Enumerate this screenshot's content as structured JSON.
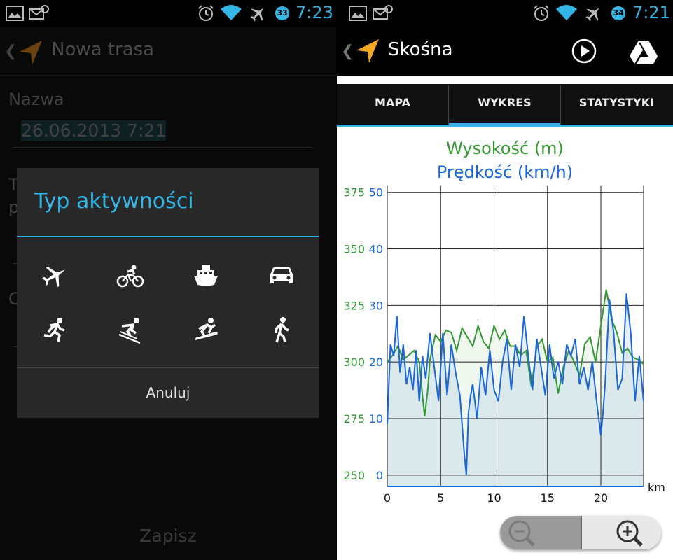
{
  "left": {
    "status": {
      "battery": "33",
      "time": "7:23"
    },
    "title": "Nowa trasa",
    "name_label": "Nazwa",
    "name_value": "26.06.2013 7:21",
    "hidden_label_fragment_1": "T",
    "hidden_label_fragment_2": "p",
    "hidden_label_fragment_3": "C",
    "dialog": {
      "title": "Typ aktywności",
      "activities": [
        "airplane-icon",
        "bicycle-icon",
        "boat-icon",
        "car-icon",
        "running-icon",
        "skiing-icon",
        "snowboarding-icon",
        "walking-icon"
      ],
      "cancel": "Anuluj"
    },
    "save_label": "Zapisz"
  },
  "right": {
    "status": {
      "battery": "34",
      "time": "7:21"
    },
    "title": "Skośna",
    "tabs": [
      {
        "label": "MAPA",
        "active": false
      },
      {
        "label": "WYKRES",
        "active": true
      },
      {
        "label": "STATYSTYKI",
        "active": false
      }
    ],
    "x_unit": "km",
    "colors": {
      "elevation": "#339933",
      "speed": "#1a66dd",
      "accent": "#33b5e5"
    }
  },
  "chart_data": {
    "type": "line",
    "title": "Wysokość (m)",
    "subtitle": "Prędkość (km/h)",
    "xlabel": "km",
    "x_ticks": [
      0,
      5,
      10,
      15,
      20
    ],
    "y_left_ticks": [
      250,
      275,
      300,
      325,
      350,
      375
    ],
    "y_right_ticks": [
      0,
      10,
      20,
      30,
      40,
      50
    ],
    "xlim": [
      0,
      24
    ],
    "ylim_left": [
      245,
      378
    ],
    "ylim_right": [
      -3,
      50
    ],
    "grid": true,
    "series": [
      {
        "name": "Wysokość (m)",
        "axis": "left",
        "x": [
          0,
          0.5,
          1,
          1.5,
          2,
          2.5,
          3,
          3.3,
          3.5,
          3.8,
          4,
          4.5,
          5,
          5.5,
          6,
          6.5,
          7,
          7.5,
          8,
          8.5,
          9,
          9.5,
          10,
          10.5,
          11,
          11.5,
          12,
          12.5,
          13,
          13.5,
          14,
          14.5,
          15,
          15.5,
          16,
          16.5,
          17,
          17.5,
          18,
          18.5,
          19,
          19.5,
          20,
          20.5,
          21,
          21.5,
          22,
          22.5,
          23,
          23.5,
          24
        ],
        "values": [
          300,
          303,
          307,
          301,
          303,
          305,
          300,
          285,
          276,
          288,
          301,
          312,
          309,
          314,
          313,
          305,
          315,
          311,
          307,
          316,
          309,
          306,
          316,
          310,
          314,
          307,
          307,
          303,
          305,
          289,
          307,
          310,
          300,
          302,
          286,
          298,
          305,
          300,
          294,
          308,
          311,
          300,
          316,
          332,
          319,
          313,
          304,
          306,
          302,
          301,
          299
        ]
      },
      {
        "name": "Prędkość (km/h)",
        "axis": "right",
        "x": [
          0,
          0.3,
          0.6,
          0.9,
          1.2,
          1.5,
          1.8,
          2.1,
          2.4,
          2.7,
          3,
          3.3,
          3.6,
          4,
          4.4,
          4.8,
          5.2,
          5.6,
          6,
          6.4,
          6.8,
          7.2,
          7.4,
          7.6,
          7.8,
          8,
          8.4,
          8.8,
          9.2,
          9.6,
          10,
          10.4,
          10.8,
          11.2,
          11.6,
          12,
          12.4,
          12.8,
          13.2,
          13.6,
          14,
          14.4,
          14.8,
          15.2,
          15.6,
          16,
          16.4,
          16.8,
          17.2,
          17.6,
          18,
          18.4,
          18.8,
          19.2,
          19.6,
          20,
          20.2,
          20.4,
          20.8,
          21.2,
          21.6,
          22,
          22.4,
          22.8,
          23.2,
          23.6,
          24
        ],
        "values": [
          8,
          22,
          20,
          27,
          17,
          22,
          15,
          18,
          14,
          21,
          12,
          20,
          16,
          24,
          18,
          12,
          24,
          13,
          22,
          17,
          13,
          3,
          -1,
          10,
          13,
          15,
          9,
          18,
          13,
          21,
          14,
          12,
          19,
          23,
          14,
          22,
          18,
          27,
          20,
          14,
          23,
          18,
          13,
          22,
          16,
          19,
          15,
          22,
          20,
          23,
          15,
          18,
          14,
          19,
          12,
          6,
          10,
          15,
          30,
          24,
          14,
          16,
          31,
          24,
          12,
          20,
          12
        ]
      }
    ]
  }
}
